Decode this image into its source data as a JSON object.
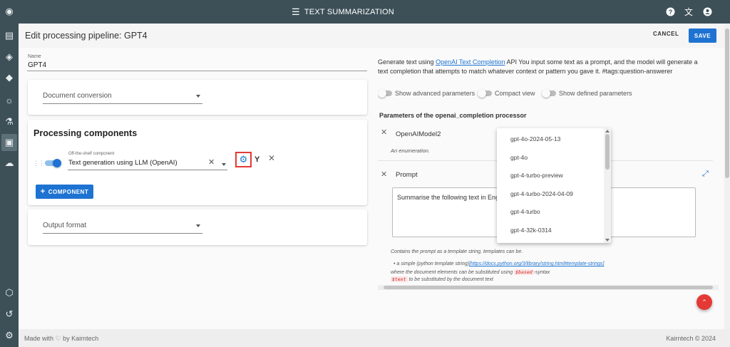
{
  "topbar": {
    "menu_icon": "hamburger-icon",
    "title": "TEXT SUMMARIZATION",
    "icons": [
      "help-icon",
      "translate-icon",
      "account-icon"
    ]
  },
  "sidebar": {
    "icons": [
      "logo-icon",
      "pipelines-icon",
      "explore-icon",
      "tags-icon",
      "lightbulb-icon",
      "flask-icon",
      "document-settings-icon",
      "cloud-sync-icon",
      "cube-icon",
      "history-icon",
      "settings-icon"
    ]
  },
  "header": {
    "title": "Edit processing pipeline: GPT4",
    "cancel": "CANCEL",
    "save": "SAVE"
  },
  "form": {
    "name_label": "Name",
    "name_value": "GPT4",
    "document_conversion": "Document conversion",
    "processing_title": "Processing components",
    "component_label": "Off-the-shelf component",
    "component_value": "Text generation using LLM (OpenAI)",
    "add_component": "COMPONENT",
    "output_format": "Output format"
  },
  "right": {
    "desc_prefix": "Generate text using ",
    "desc_link": "OpenAI Text Completion",
    "desc_suffix": " API You input some text as a prompt, and the model will generate a text completion that attempts to match whatever context or pattern you gave it. #tags:question-answerer",
    "switch_advanced": "Show advanced parameters",
    "switch_compact": "Compact view",
    "switch_defined": "Show defined parameters",
    "params_title": "Parameters of the openai_completion processor",
    "param1_name": "OpenAIModel2",
    "param1_note": "An enumeration.",
    "param2_name": "Prompt",
    "prompt_text": "Summarise the following text in Engli",
    "help1": "Contains the prompt as a template string, templates can be.",
    "help2_prefix": "• a simple (python template string)",
    "help2_link": "[https://docs.python.org/3/library/string.html#template-strings]",
    "help3_prefix": "where the document elements can be substituted using ",
    "help3_code": "$based",
    "help3_suffix": "-syntax",
    "help4_code": "$text",
    "help4_suffix": " to be substituted by the document text"
  },
  "dropdown": {
    "options": [
      "gpt-4o-2024-05-13",
      "gpt-4o",
      "gpt-4-turbo-preview",
      "gpt-4-turbo-2024-04-09",
      "gpt-4-turbo",
      "gpt-4-32k-0314"
    ]
  },
  "footer": {
    "left": "Made with ♡ by Kairntech",
    "right": "Kairntech © 2024"
  },
  "colors": {
    "primary": "#1e73d2",
    "appbar": "#3d5058",
    "highlight": "#e53935"
  }
}
